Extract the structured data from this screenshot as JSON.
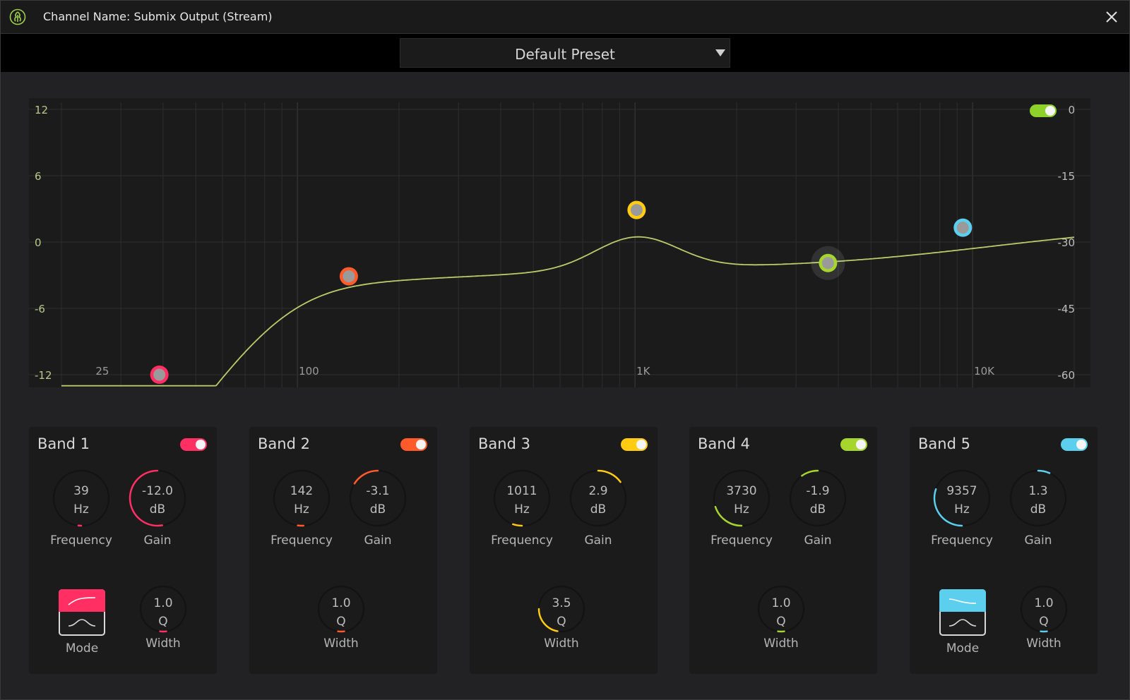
{
  "window": {
    "title": "Channel Name: Submix Output (Stream)"
  },
  "preset": {
    "label": "Default Preset"
  },
  "graph": {
    "left_axis": [
      "12",
      "6",
      "0",
      "-6",
      "-12"
    ],
    "right_axis": [
      "0",
      "-15",
      "-30",
      "-45",
      "-60"
    ],
    "freq_labels": [
      "25",
      "100",
      "1K",
      "10K"
    ],
    "master_enabled": true,
    "master_color": "#8fd12b"
  },
  "bands": [
    {
      "title": "Band 1",
      "color": "#ff2f64",
      "enabled": true,
      "frequency": {
        "value": "39",
        "unit": "Hz",
        "label": "Frequency"
      },
      "gain": {
        "value": "-12.0",
        "unit": "dB",
        "label": "Gain"
      },
      "width": {
        "value": "1.0",
        "unit": "Q",
        "label": "Width"
      },
      "mode": {
        "label": "Mode",
        "icon": "high-pass-filter-icon"
      }
    },
    {
      "title": "Band 2",
      "color": "#ff5a2a",
      "enabled": true,
      "frequency": {
        "value": "142",
        "unit": "Hz",
        "label": "Frequency"
      },
      "gain": {
        "value": "-3.1",
        "unit": "dB",
        "label": "Gain"
      },
      "width": {
        "value": "1.0",
        "unit": "Q",
        "label": "Width"
      }
    },
    {
      "title": "Band 3",
      "color": "#ffcc11",
      "enabled": true,
      "frequency": {
        "value": "1011",
        "unit": "Hz",
        "label": "Frequency"
      },
      "gain": {
        "value": "2.9",
        "unit": "dB",
        "label": "Gain"
      },
      "width": {
        "value": "3.5",
        "unit": "Q",
        "label": "Width"
      }
    },
    {
      "title": "Band 4",
      "color": "#a6d62e",
      "enabled": true,
      "frequency": {
        "value": "3730",
        "unit": "Hz",
        "label": "Frequency"
      },
      "gain": {
        "value": "-1.9",
        "unit": "dB",
        "label": "Gain"
      },
      "width": {
        "value": "1.0",
        "unit": "Q",
        "label": "Width"
      }
    },
    {
      "title": "Band 5",
      "color": "#5ccfee",
      "enabled": true,
      "frequency": {
        "value": "9357",
        "unit": "Hz",
        "label": "Frequency"
      },
      "gain": {
        "value": "1.3",
        "unit": "dB",
        "label": "Gain"
      },
      "width": {
        "value": "1.0",
        "unit": "Q",
        "label": "Width"
      },
      "mode": {
        "label": "Mode",
        "icon": "high-shelf-filter-icon"
      }
    }
  ]
}
